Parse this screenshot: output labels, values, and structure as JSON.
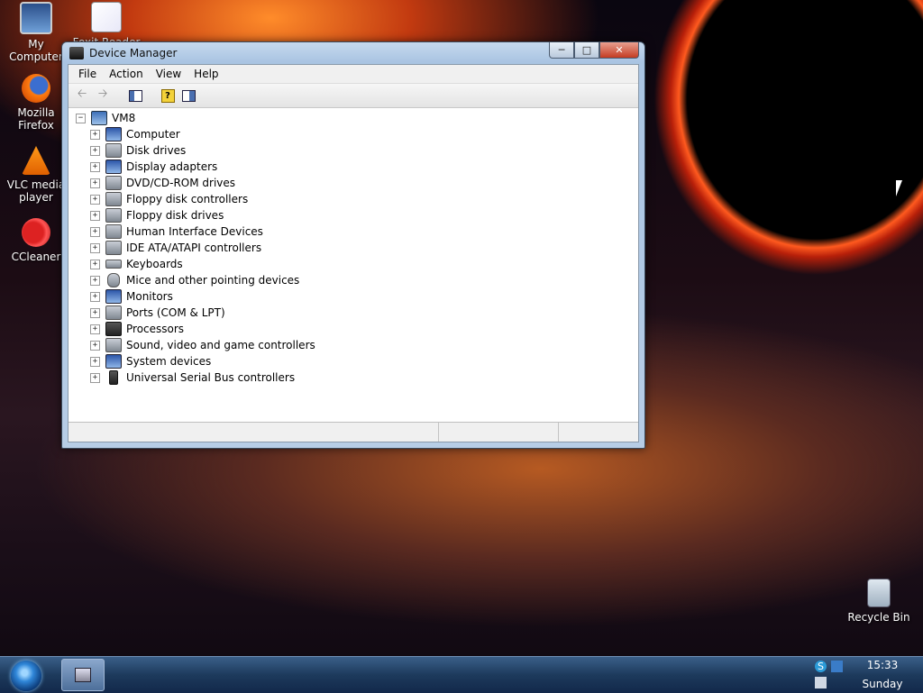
{
  "desktop": {
    "icons": [
      {
        "label": "My Computer"
      },
      {
        "label": "Foxit Reader"
      },
      {
        "label": "Mozilla Firefox"
      },
      {
        "label": "VLC media player"
      },
      {
        "label": "CCleaner"
      },
      {
        "label": "Recycle Bin"
      }
    ]
  },
  "window": {
    "title": "Device Manager",
    "menu": [
      "File",
      "Action",
      "View",
      "Help"
    ],
    "tree": {
      "root": "VM8",
      "items": [
        "Computer",
        "Disk drives",
        "Display adapters",
        "DVD/CD-ROM drives",
        "Floppy disk controllers",
        "Floppy disk drives",
        "Human Interface Devices",
        "IDE ATA/ATAPI controllers",
        "Keyboards",
        "Mice and other pointing devices",
        "Monitors",
        "Ports (COM & LPT)",
        "Processors",
        "Sound, video and game controllers",
        "System devices",
        "Universal Serial Bus controllers"
      ]
    }
  },
  "taskbar": {
    "clock_time": "15:33",
    "clock_day": "Sunday"
  }
}
